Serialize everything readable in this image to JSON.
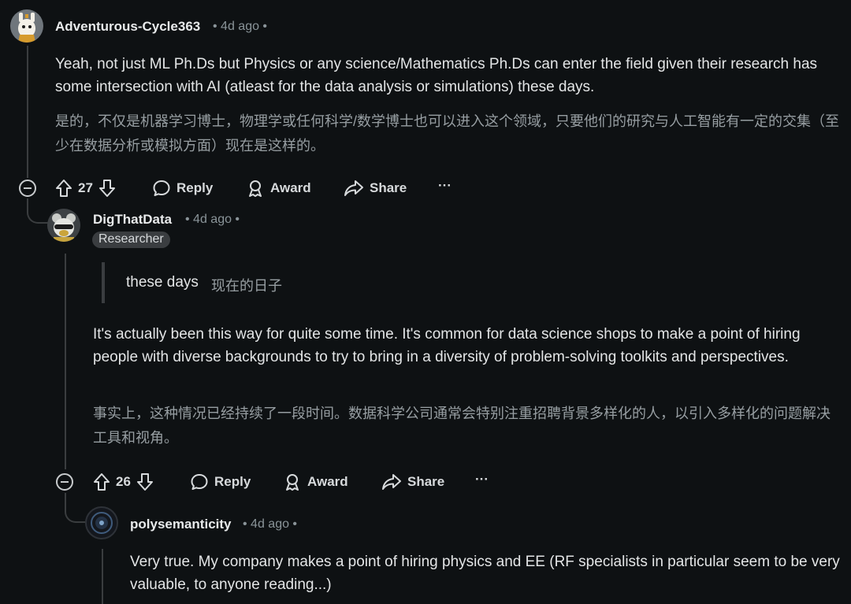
{
  "comments": [
    {
      "author": "Adventurous-Cycle363",
      "time": "• 4d ago •",
      "body_en": "Yeah, not just ML Ph.Ds but Physics or any science/Mathematics Ph.Ds can enter the field given their research has some intersection with AI (atleast for the data analysis or simulations) these days.",
      "body_zh": "是的，不仅是机器学习博士，物理学或任何科学/数学博士也可以进入这个领域，只要他们的研究与人工智能有一定的交集（至少在数据分析或模拟方面）现在是这样的。",
      "votes": "27",
      "actions": {
        "reply": "Reply",
        "award": "Award",
        "share": "Share",
        "more": "···"
      }
    },
    {
      "author": "DigThatData",
      "time": "• 4d ago •",
      "flair": "Researcher",
      "quote_en": "these days",
      "quote_zh": "现在的日子",
      "body_en": "It's actually been this way for quite some time. It's common for data science shops to make a point of hiring people with diverse backgrounds to try to bring in a diversity of problem-solving toolkits and perspectives.",
      "body_zh": "事实上，这种情况已经持续了一段时间。数据科学公司通常会特别注重招聘背景多样化的人，以引入多样化的问题解决工具和视角。",
      "votes": "26",
      "actions": {
        "reply": "Reply",
        "award": "Award",
        "share": "Share",
        "more": "···"
      }
    },
    {
      "author": "polysemanticity",
      "time": "• 4d ago •",
      "body_en": "Very true. My company makes a point of hiring physics and EE (RF specialists in particular seem to be very valuable, to anyone reading...)"
    }
  ],
  "icons": {
    "collapse": "collapse-minus-icon",
    "upvote": "arrow-up-icon",
    "downvote": "arrow-down-icon",
    "reply": "speech-bubble-icon",
    "award": "award-ribbon-icon",
    "share": "share-arrow-icon"
  },
  "colors": {
    "background": "#0e1113",
    "text": "#e3e5e6",
    "muted": "#8a9499",
    "thread": "#3a3d3f"
  }
}
